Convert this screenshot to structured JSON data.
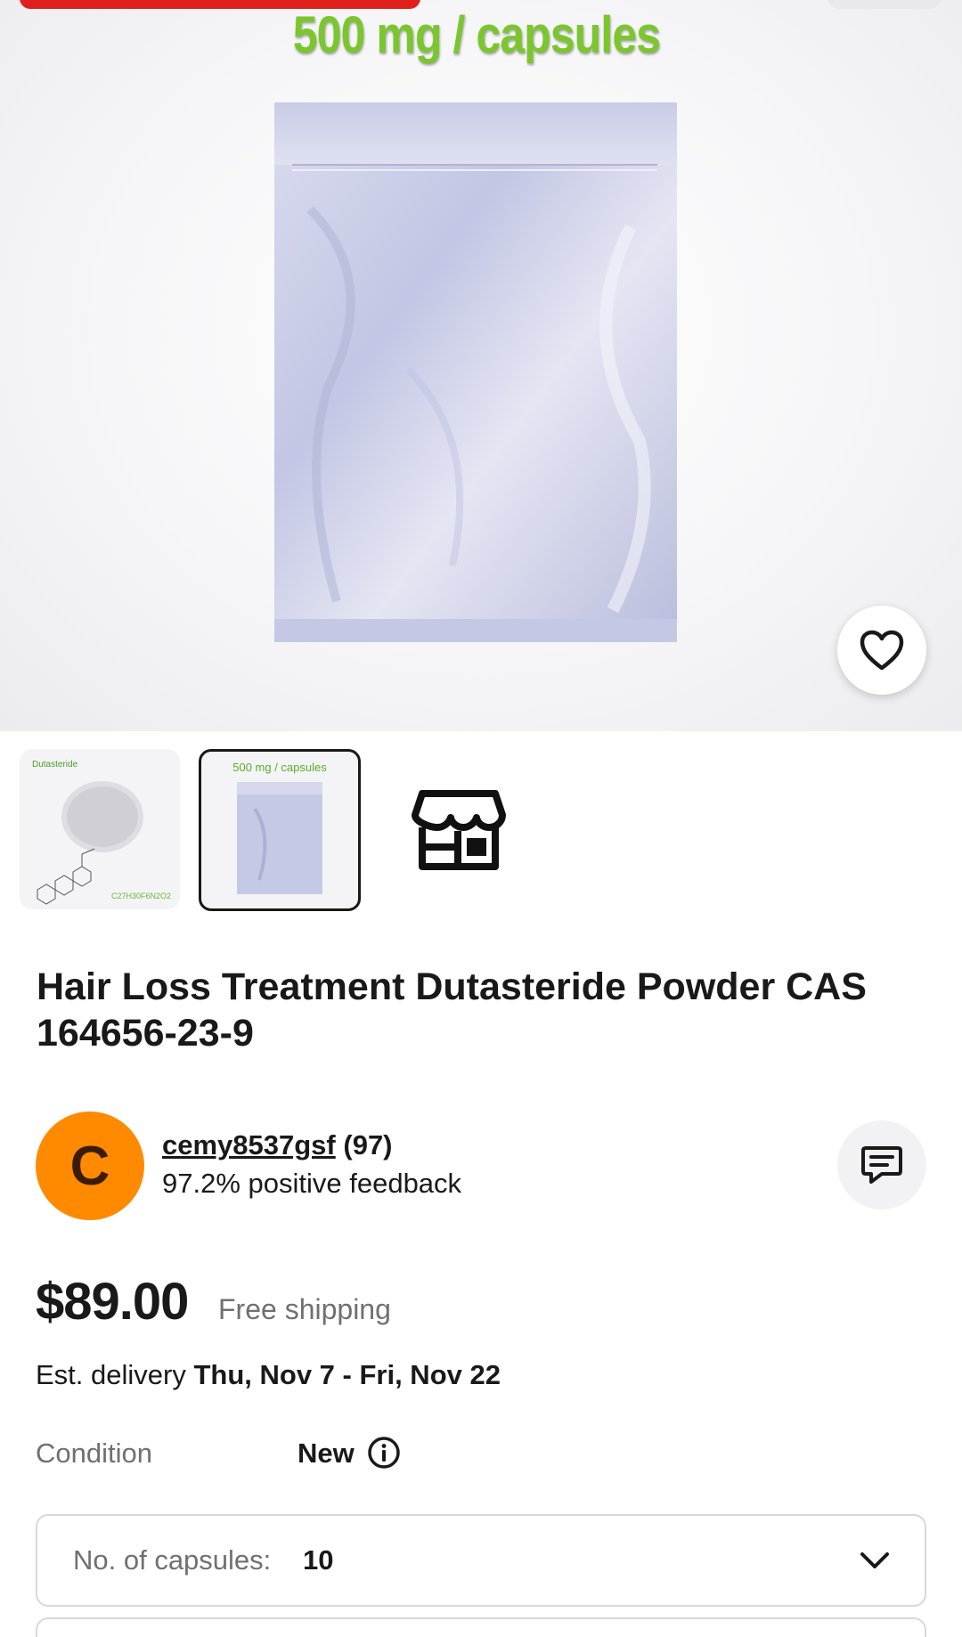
{
  "hero": {
    "caption": "500 mg / capsules",
    "favorite_icon": "heart-icon"
  },
  "thumbnails": [
    {
      "title": "Dutasteride",
      "formula": "C27H30F6N2O2",
      "selected": false
    },
    {
      "title": "500 mg / capsules",
      "selected": true
    },
    {
      "icon": "store-icon"
    }
  ],
  "product": {
    "title": "Hair Loss Treatment Dutasteride Powder CAS 164656-23-9"
  },
  "seller": {
    "avatar_letter": "C",
    "name": "cemy8537gsf",
    "feedback_count": "(97)",
    "feedback_percent": "97.2% positive feedback",
    "message_icon": "message-icon"
  },
  "pricing": {
    "price": "$89.00",
    "shipping": "Free shipping",
    "delivery_label": "Est. delivery",
    "delivery_dates": "Thu, Nov 7 - Fri, Nov 22"
  },
  "condition": {
    "label": "Condition",
    "value": "New"
  },
  "variant_select": {
    "label": "No. of capsules:",
    "value": "10"
  },
  "colors": {
    "accent_red": "#e0201c",
    "caption_green": "#7bc62d",
    "avatar_orange": "#ff8a00",
    "text": "#191919",
    "muted": "#707070"
  }
}
